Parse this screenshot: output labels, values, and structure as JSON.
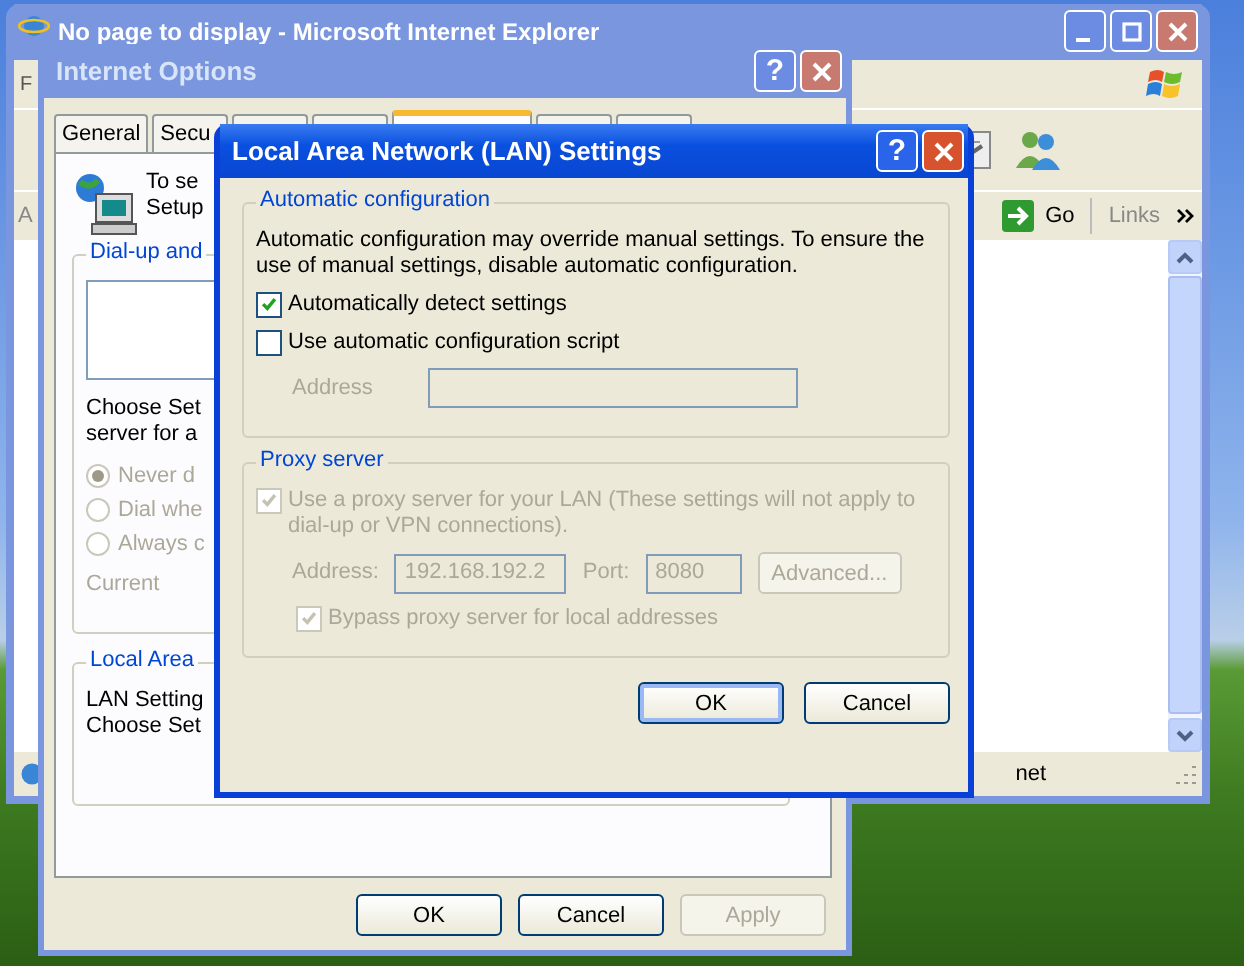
{
  "browser_window": {
    "title": "No page to display - Microsoft Internet Explorer",
    "menu_item": "F",
    "address_label": "A",
    "go_button": "Go",
    "links_label": "Links",
    "status_text": "net"
  },
  "internet_options": {
    "title": "Internet Options",
    "help_button": "?",
    "tabs": [
      {
        "label": "General",
        "selected": false
      },
      {
        "label": "Secu",
        "selected": false
      },
      {
        "selected": false
      },
      {
        "selected": false
      },
      {
        "selected": true
      },
      {
        "selected": false
      },
      {
        "selected": false
      }
    ],
    "intro_lines": [
      "To se",
      "Setup"
    ],
    "dialup_group": {
      "legend": "Dial-up and",
      "note_lines": [
        "Choose Set",
        "server for a"
      ],
      "options": [
        {
          "label": "Never d",
          "selected": true,
          "disabled": true
        },
        {
          "label": "Dial whe",
          "selected": false,
          "disabled": true
        },
        {
          "label": "Always c",
          "selected": false,
          "disabled": true
        }
      ],
      "current_label": "Current"
    },
    "lan_group": {
      "legend": "Local Area",
      "lines": [
        "LAN Setting",
        "Choose Set"
      ]
    },
    "buttons": [
      {
        "label": "OK",
        "disabled": false
      },
      {
        "label": "Cancel",
        "disabled": false
      },
      {
        "label": "Apply",
        "disabled": true
      }
    ]
  },
  "lan_dialog": {
    "title": "Local Area Network (LAN) Settings",
    "help_button": "?",
    "automatic_configuration": {
      "legend": "Automatic configuration",
      "description": "Automatic configuration may override manual settings.  To ensure the use of manual settings, disable automatic configuration.",
      "options": [
        {
          "label": "Automatically detect settings",
          "checked": true,
          "disabled": false
        },
        {
          "label": "Use automatic configuration script",
          "checked": false,
          "disabled": false
        }
      ],
      "address_label": "Address",
      "address_disabled": true
    },
    "proxy_server": {
      "legend": "Proxy server",
      "use_proxy": {
        "label": "Use a proxy server for your LAN (These settings will not apply to dial-up or VPN connections).",
        "checked": true,
        "disabled": true
      },
      "address_label": "Address:",
      "address_value": "192.168.192.2",
      "port_label": "Port:",
      "port_value": "8080",
      "advanced_button": "Advanced...",
      "disabled": true,
      "bypass": {
        "label": "Bypass proxy server for local addresses",
        "checked": true,
        "disabled": true
      }
    },
    "buttons": [
      {
        "label": "OK",
        "default": true
      },
      {
        "label": "Cancel",
        "default": false
      }
    ]
  }
}
